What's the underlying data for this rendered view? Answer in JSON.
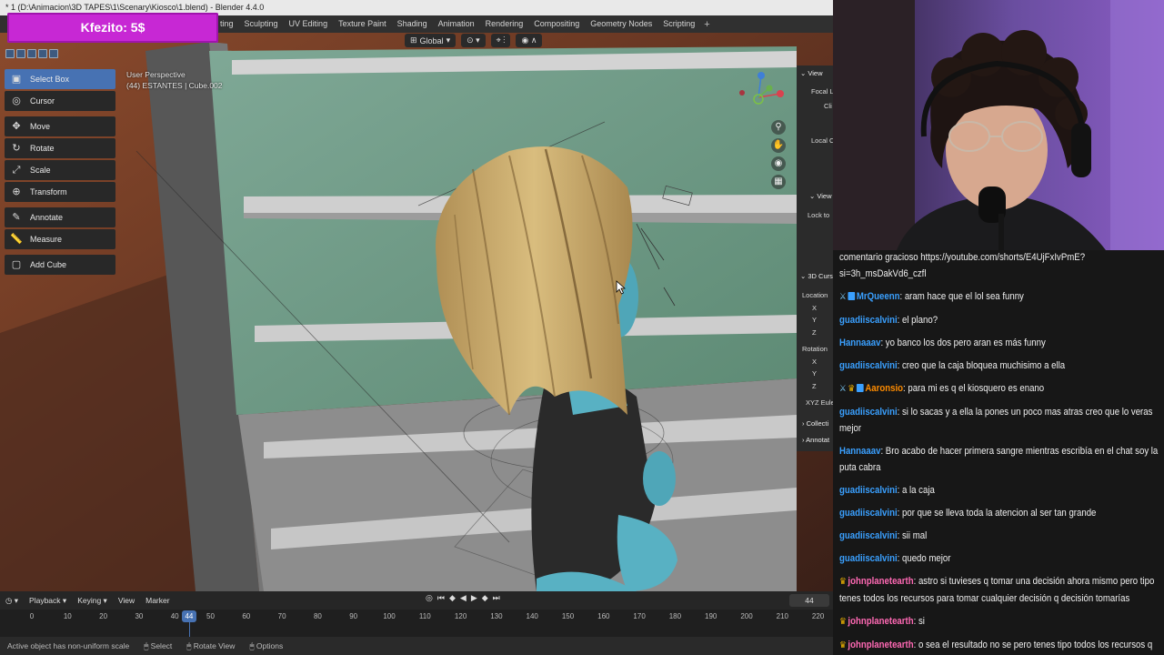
{
  "window": {
    "title": "* 1 (D:\\Animacion\\3D TAPES\\1\\Scenary\\Kiosco\\1.blend) - Blender 4.4.0"
  },
  "donation": {
    "text": "Kfezito: 5$"
  },
  "workspaces": [
    "ting",
    "Sculpting",
    "UV Editing",
    "Texture Paint",
    "Shading",
    "Animation",
    "Rendering",
    "Compositing",
    "Geometry Nodes",
    "Scripting"
  ],
  "header": {
    "orientation": "Global"
  },
  "toolbar": {
    "tools": [
      {
        "label": "Select Box",
        "icon": "select-box-icon",
        "glyph": "▣",
        "active": true
      },
      {
        "label": "Cursor",
        "icon": "cursor-icon",
        "glyph": "◎",
        "active": false
      },
      {
        "label": "Move",
        "icon": "move-icon",
        "glyph": "✥",
        "active": false
      },
      {
        "label": "Rotate",
        "icon": "rotate-icon",
        "glyph": "↻",
        "active": false
      },
      {
        "label": "Scale",
        "icon": "scale-icon",
        "glyph": "⤢",
        "active": false
      },
      {
        "label": "Transform",
        "icon": "transform-icon",
        "glyph": "⊕",
        "active": false
      },
      {
        "label": "Annotate",
        "icon": "annotate-icon",
        "glyph": "✎",
        "active": false
      },
      {
        "label": "Measure",
        "icon": "measure-icon",
        "glyph": "📏",
        "active": false
      },
      {
        "label": "Add Cube",
        "icon": "add-cube-icon",
        "glyph": "▢",
        "active": false
      }
    ]
  },
  "viewport": {
    "perspective": "User Perspective",
    "object": "(44) ESTANTES | Cube.002"
  },
  "npanel": {
    "view_tab": "View",
    "focal": "Focal L",
    "clip": "Cli",
    "local": "Local C",
    "view2": "View",
    "lock": "Lock to",
    "cursor_tab": "3D Curs",
    "location": "Location",
    "x": "X",
    "y": "Y",
    "z": "Z",
    "rotation": "Rotation",
    "euler": "XYZ Eule",
    "collections": "Collecti",
    "annotations": "Annotat"
  },
  "timeline": {
    "menus": [
      "Playback",
      "Keying",
      "View",
      "Marker"
    ],
    "current_frame": "44",
    "ticks": [
      "0",
      "10",
      "20",
      "30",
      "40",
      "50",
      "60",
      "70",
      "80",
      "90",
      "100",
      "110",
      "120",
      "130",
      "140",
      "150",
      "160",
      "170",
      "180",
      "190",
      "200",
      "210",
      "220"
    ]
  },
  "status": {
    "message": "Active object has non-uniform scale",
    "select": "Select",
    "rotate_view": "Rotate View",
    "options": "Options"
  },
  "chat": {
    "messages": [
      {
        "user": "",
        "color": "#f1f1f1",
        "text": "comentario gracioso https://youtube.com/shorts/E4UjFxIvPmE?si=3h_msDakVd6_czfl",
        "badge": ""
      },
      {
        "user": "MrQueenn",
        "color": "#3aa0ff",
        "text": "aram hace que el lol sea funny",
        "badge": "sword"
      },
      {
        "user": "guadiiscalvini",
        "color": "#3aa0ff",
        "text": "el plano?",
        "badge": ""
      },
      {
        "user": "Hannaaav",
        "color": "#3aa0ff",
        "text": "yo banco los dos pero aran es más funny",
        "badge": ""
      },
      {
        "user": "guadiiscalvini",
        "color": "#3aa0ff",
        "text": "creo que la caja bloquea muchisimo a ella",
        "badge": ""
      },
      {
        "user": "Aaronsio",
        "color": "#ff8c00",
        "text": "para mi es q el kiosquero es enano",
        "badge": "sword-crown"
      },
      {
        "user": "guadiiscalvini",
        "color": "#3aa0ff",
        "text": "si lo sacas y a ella la pones un poco mas atras creo que lo veras mejor",
        "badge": ""
      },
      {
        "user": "Hannaaav",
        "color": "#3aa0ff",
        "text": "Bro acabo de hacer primera sangre mientras escribía en el chat soy la puta cabra",
        "badge": ""
      },
      {
        "user": "guadiiscalvini",
        "color": "#3aa0ff",
        "text": "a la caja",
        "badge": ""
      },
      {
        "user": "guadiiscalvini",
        "color": "#3aa0ff",
        "text": "por que se lleva toda la atencion al ser tan grande",
        "badge": ""
      },
      {
        "user": "guadiiscalvini",
        "color": "#3aa0ff",
        "text": "sii mal",
        "badge": ""
      },
      {
        "user": "guadiiscalvini",
        "color": "#3aa0ff",
        "text": "quedo mejor",
        "badge": ""
      },
      {
        "user": "johnplanetearth",
        "color": "#ff69b4",
        "text": "astro si tuvieses q tomar una decisión ahora mismo pero tipo tenes todos los recursos para tomar cualquier decisión q decisión tomarías",
        "badge": "crown"
      },
      {
        "user": "johnplanetearth",
        "color": "#ff69b4",
        "text": "si",
        "badge": "crown"
      },
      {
        "user": "johnplanetearth",
        "color": "#ff69b4",
        "text": "o sea el resultado no se pero tenes tipo todos los recursos q te lo permitan",
        "badge": "crown"
      }
    ]
  },
  "colors": {
    "accent": "#4772b3",
    "donation": "#c728d4",
    "wall": "#6f9a82",
    "hair": "#c9a867",
    "skin": "#4fa6b8"
  }
}
